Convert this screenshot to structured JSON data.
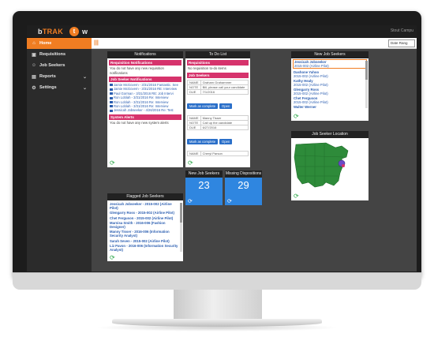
{
  "header": {
    "logo_prefix": "b",
    "logo_accent": "TRAK",
    "logo_badge": "t",
    "logo_suffix": "w",
    "user": "Stout Campu",
    "menu_glyph": "|||",
    "date_range": "Date Rang"
  },
  "sidebar": {
    "items": [
      {
        "label": "Home",
        "icon": "home-icon"
      },
      {
        "label": "Requisitions",
        "icon": "briefcase-icon"
      },
      {
        "label": "Job Seekers",
        "icon": "users-icon"
      },
      {
        "label": "Reports",
        "icon": "document-icon"
      },
      {
        "label": "Settings",
        "icon": "gear-icon"
      }
    ]
  },
  "notifications": {
    "title": "Notifications",
    "req_heading": "Requisition Notifications",
    "req_empty": "You do not have any new requisition notifications",
    "seeker_heading": "Job Seeker Notifications",
    "seeker_items": [
      "Jamie McGovern - 3/31/2016 Fantastic. See",
      "Jamie McGovern - 3/31/2016 RE: Interview",
      "Paul Gorman - 3/31/2016 RE: Job Intervi",
      "Ron Loblah - 3/31/2016 Re: Interview",
      "Ron Loblah - 3/31/2016 Re: Interview",
      "Ron Loblah - 3/31/2016 Re: Interview",
      "Jessicah Jobseeker - 4/26/2016 Re: Test"
    ],
    "alerts_heading": "System Alerts",
    "alerts_empty": "You do not have any new system alerts"
  },
  "todo": {
    "title": "To Do List",
    "req_heading": "Requisitions",
    "req_empty": "No requisition to-do items",
    "seeker_heading": "Job Seekers",
    "labels": {
      "name": "NAME",
      "note": "NOTE",
      "due": "DUE"
    },
    "tasks": [
      {
        "name": "Graham Grahammer",
        "note": "Bill, please call your candidate",
        "due": "7/1/2016"
      },
      {
        "name": "Manny Tisser",
        "note": "Call up the candidate",
        "due": "6/27/2016"
      },
      {
        "name": "Cheryl Parson"
      }
    ],
    "mark_complete": "Mark as complete",
    "open": "Open"
  },
  "new_seekers": {
    "title": "New Job Seekers",
    "items": [
      {
        "name": "Jessicah Jobseeker",
        "req": "2015-002 (Airline Pilot)"
      },
      {
        "name": "Dashone Yahoo",
        "req": "2015-002 (Airline Pilot)"
      },
      {
        "name": "Kathy Healy",
        "req": "2015-002 (Airline Pilot)"
      },
      {
        "name": "Glengarry Ross",
        "req": "2015-002 (Airline Pilot)"
      },
      {
        "name": "Chet Ferguson",
        "req": "2015-002 (Airline Pilot)"
      },
      {
        "name": "Walter Werner",
        "req": ""
      }
    ]
  },
  "location": {
    "title": "Job Seeker Location"
  },
  "flagged": {
    "title": "Flagged Job Seekers",
    "items": [
      "Jessicah Jobseeker - 2015-002 (Airline Pilot)",
      "Glengarry Ross - 2015-002 (Airline Pilot)",
      "Chet Ferguson - 2015-002 (Airline Pilot)",
      "Marnisa Smith - 2016-006 (Fashion Designer)",
      "Manny Tisser - 2016-006 (Information Security Analyst)",
      "Sarah Seven - 2015-002 (Airline Pilot)",
      "Liz Pavon - 2016-006 (Information Security Analyst)"
    ]
  },
  "stats": {
    "new_seekers_label": "New Job Seekers",
    "new_seekers_value": "23",
    "missing_label": "Missing Dispositions",
    "missing_value": "29"
  },
  "colors": {
    "accent": "#f07d22",
    "pink": "#d6336c",
    "tile": "#2f86e0",
    "link": "#2a5db0",
    "map_green": "#2e8b3a"
  }
}
